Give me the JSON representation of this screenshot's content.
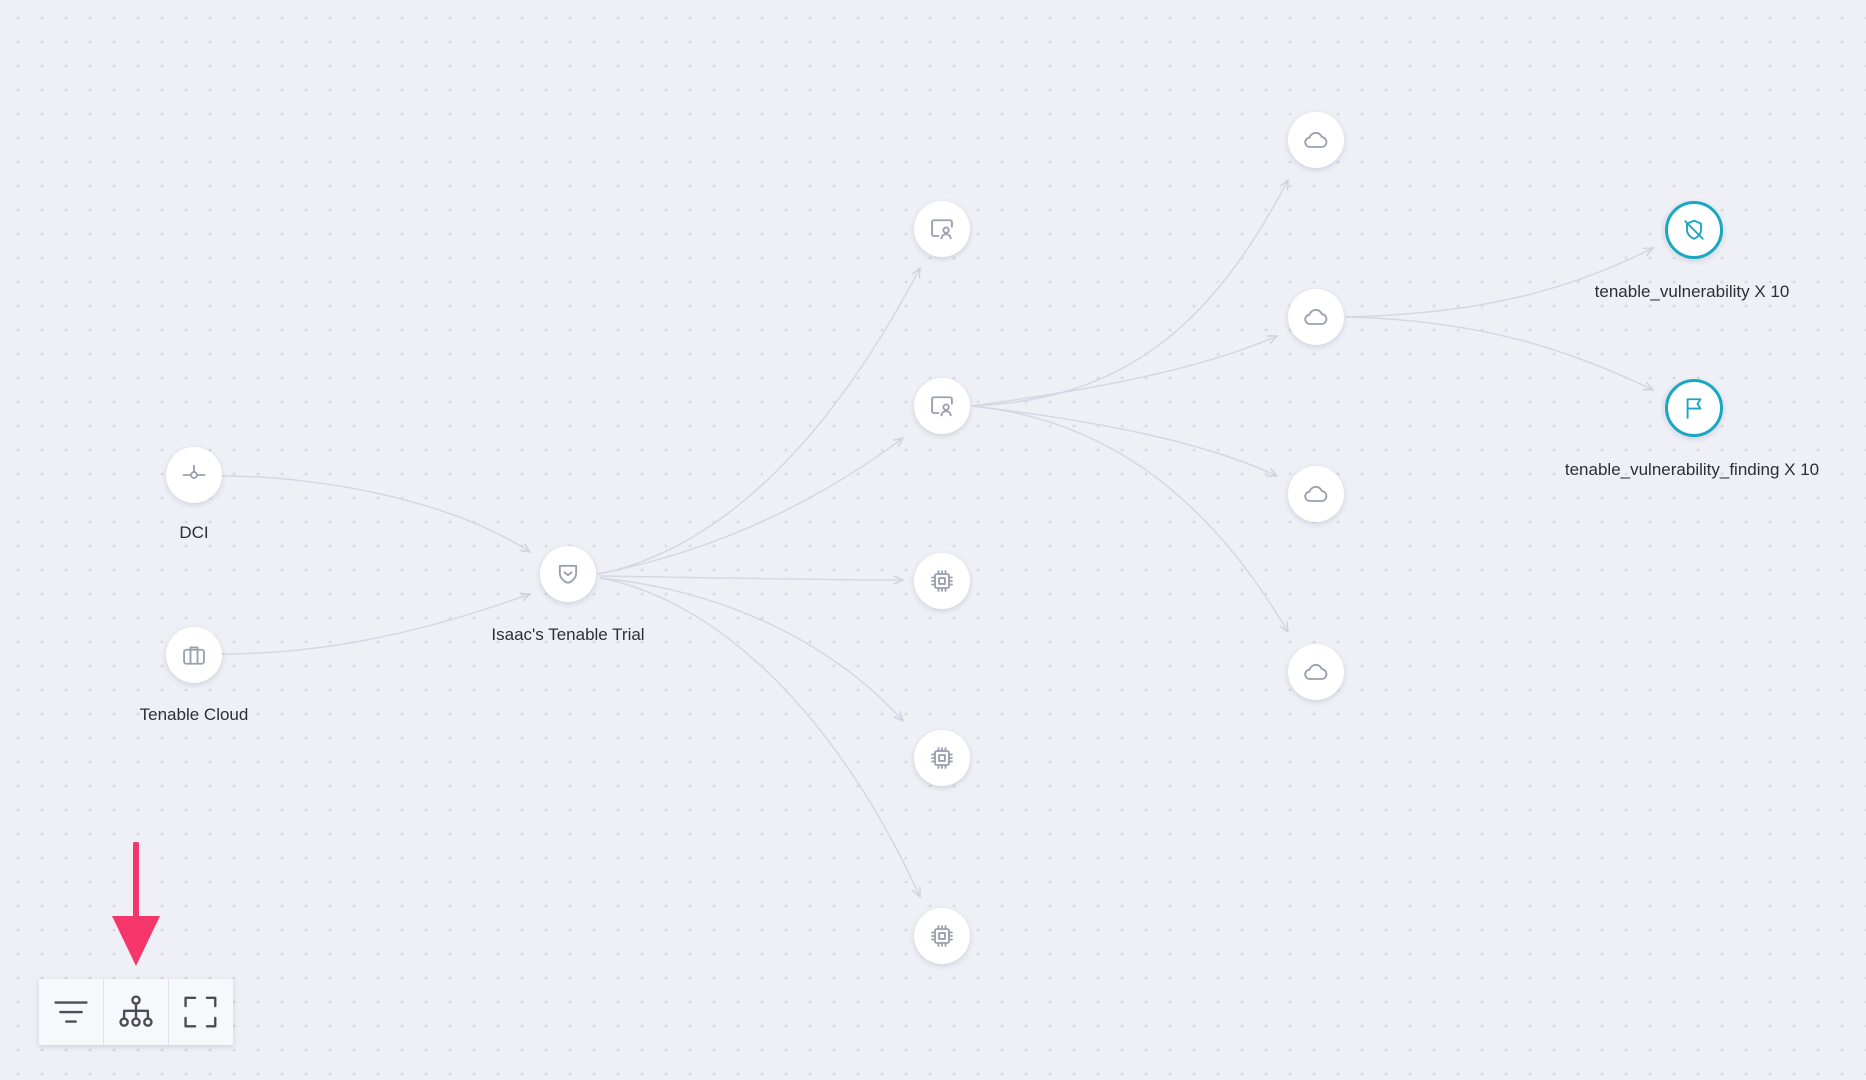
{
  "graph": {
    "nodes": [
      {
        "id": "dci",
        "label": "DCI",
        "icon": "connector-icon"
      },
      {
        "id": "tenable-cloud",
        "label": "Tenable Cloud",
        "icon": "briefcase-icon"
      },
      {
        "id": "trial",
        "label": "Isaac's Tenable Trial",
        "icon": "shield-account-icon"
      },
      {
        "id": "user-a",
        "label": "",
        "icon": "user-screen-icon"
      },
      {
        "id": "user-b",
        "label": "",
        "icon": "user-screen-icon"
      },
      {
        "id": "chip-a",
        "label": "",
        "icon": "chip-icon"
      },
      {
        "id": "chip-b",
        "label": "",
        "icon": "chip-icon"
      },
      {
        "id": "chip-c",
        "label": "",
        "icon": "chip-icon"
      },
      {
        "id": "cloud-a",
        "label": "",
        "icon": "cloud-icon"
      },
      {
        "id": "cloud-b",
        "label": "",
        "icon": "cloud-icon"
      },
      {
        "id": "cloud-c",
        "label": "",
        "icon": "cloud-icon"
      },
      {
        "id": "cloud-d",
        "label": "",
        "icon": "cloud-icon"
      },
      {
        "id": "vuln",
        "label": "tenable_vulnerability X 10",
        "icon": "shield-off-icon",
        "accent": "#19a7c2"
      },
      {
        "id": "finding",
        "label": "tenable_vulnerability_finding X 10",
        "icon": "flag-icon",
        "accent": "#19a7c2"
      }
    ],
    "edges": [
      [
        "dci",
        "trial"
      ],
      [
        "tenable-cloud",
        "trial"
      ],
      [
        "trial",
        "user-a"
      ],
      [
        "trial",
        "user-b"
      ],
      [
        "trial",
        "chip-a"
      ],
      [
        "trial",
        "chip-b"
      ],
      [
        "trial",
        "chip-c"
      ],
      [
        "user-b",
        "cloud-a"
      ],
      [
        "user-b",
        "cloud-b"
      ],
      [
        "user-b",
        "cloud-c"
      ],
      [
        "user-b",
        "cloud-d"
      ],
      [
        "cloud-b",
        "vuln"
      ],
      [
        "cloud-b",
        "finding"
      ]
    ],
    "edge_color": "#d5d7e3"
  },
  "toolbar": {
    "buttons": [
      {
        "name": "filter-button",
        "icon": "filter-icon"
      },
      {
        "name": "hierarchy-layout-button",
        "icon": "hierarchy-icon"
      },
      {
        "name": "fullscreen-button",
        "icon": "fullscreen-icon"
      }
    ]
  },
  "annotation": {
    "color": "#f4366b",
    "target": "hierarchy-layout-button"
  }
}
